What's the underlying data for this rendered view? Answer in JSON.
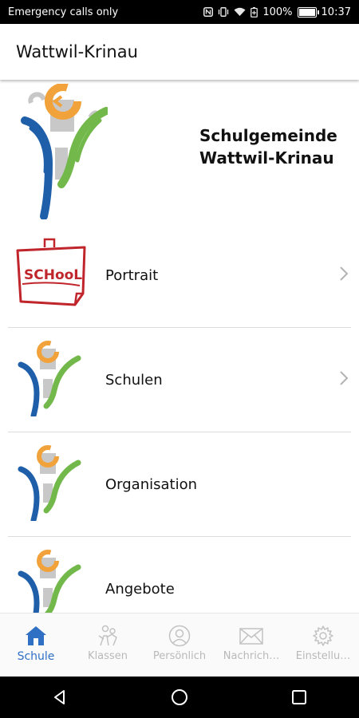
{
  "status_bar": {
    "carrier_text": "Emergency calls only",
    "battery_percent": "100%",
    "time": "10:37",
    "icons": [
      "nfc-icon",
      "vibrate-icon",
      "wifi-icon",
      "battery-saver-icon",
      "battery-icon"
    ]
  },
  "app_bar": {
    "title": "Wattwil-Krinau"
  },
  "header": {
    "line1": "Schulgemeinde",
    "line2": "Wattwil-Krinau"
  },
  "list": [
    {
      "label": "Portrait",
      "icon": "school-sign-icon",
      "has_chevron": true
    },
    {
      "label": "Schulen",
      "icon": "school-logo-icon",
      "has_chevron": true
    },
    {
      "label": "Organisation",
      "icon": "school-logo-icon",
      "has_chevron": false
    },
    {
      "label": "Angebote",
      "icon": "school-logo-icon",
      "has_chevron": false
    }
  ],
  "tabs": [
    {
      "label": "Schule",
      "icon": "home-icon",
      "active": true
    },
    {
      "label": "Klassen",
      "icon": "students-icon",
      "active": false
    },
    {
      "label": "Persönlich",
      "icon": "person-icon",
      "active": false
    },
    {
      "label": "Nachrich…",
      "icon": "mail-icon",
      "active": false
    },
    {
      "label": "Einstellu…",
      "icon": "gear-icon",
      "active": false
    }
  ],
  "colors": {
    "accent": "#2f6fc4",
    "inactive": "#b9b9b9",
    "logo_orange": "#f2a23a",
    "logo_blue": "#1f5ea8",
    "logo_green": "#72b84a",
    "logo_gray": "#c8c8c8"
  }
}
